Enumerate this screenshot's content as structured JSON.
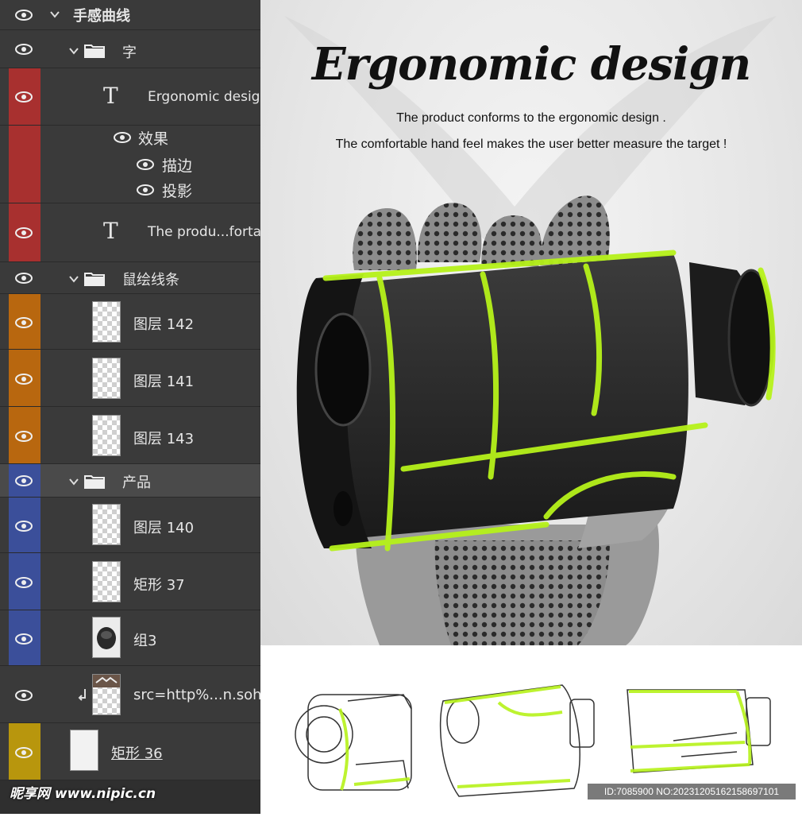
{
  "layers_panel": {
    "rows": [
      {
        "kind": "group",
        "name": "手感曲线",
        "color": "#3a3a3a"
      },
      {
        "kind": "group",
        "name": "字",
        "color": "#3a3a3a"
      },
      {
        "kind": "text",
        "name": "Ergonomic desig",
        "color": "#a8302f"
      },
      {
        "kind": "effects",
        "effects_label": "效果",
        "effect1": "描边",
        "effect2": "投影",
        "color": "#a8302f"
      },
      {
        "kind": "text",
        "name": "The produ...forta",
        "color": "#a8302f"
      },
      {
        "kind": "group",
        "name": "鼠绘线条",
        "color": "#3a3a3a"
      },
      {
        "kind": "layer",
        "name": "图层 142",
        "color": "#b8670f"
      },
      {
        "kind": "layer",
        "name": "图层 141",
        "color": "#b8670f"
      },
      {
        "kind": "layer",
        "name": "图层 143",
        "color": "#b8670f"
      },
      {
        "kind": "group",
        "name": "产品",
        "color": "#3b4f9a"
      },
      {
        "kind": "layer",
        "name": "图层 140",
        "color": "#3b4f9a"
      },
      {
        "kind": "layer",
        "name": "矩形 37",
        "color": "#3b4f9a"
      },
      {
        "kind": "layer",
        "name": "组3",
        "color": "#3b4f9a"
      },
      {
        "kind": "layer",
        "name": "src=http%...n.soh",
        "color": "#3a3a3a"
      },
      {
        "kind": "layer",
        "name": "矩形 36",
        "color": "#b8960d"
      }
    ],
    "watermark": "昵享网 www.nipic.cn"
  },
  "product": {
    "title": "Ergonomic design",
    "line1": "The product conforms to the ergonomic design .",
    "line2": "The comfortable hand feel makes the user better measure the target !"
  },
  "footer": {
    "id_tag": "ID:7085900 NO:20231205162158697101"
  },
  "colors": {
    "accent_green": "#b6f21a",
    "panel_bg": "#3a3a3a"
  }
}
